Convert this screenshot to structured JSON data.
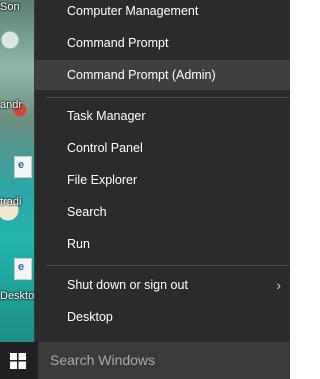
{
  "desktop": {
    "labels": [
      "Son",
      "andr",
      "tradi",
      "Desktop"
    ]
  },
  "menu": {
    "items": [
      {
        "label": "Computer Management"
      },
      {
        "label": "Command Prompt"
      },
      {
        "label": "Command Prompt (Admin)"
      },
      {
        "label": "Task Manager"
      },
      {
        "label": "Control Panel"
      },
      {
        "label": "File Explorer"
      },
      {
        "label": "Search"
      },
      {
        "label": "Run"
      },
      {
        "label": "Shut down or sign out"
      },
      {
        "label": "Desktop"
      }
    ]
  },
  "taskbar": {
    "start_icon": "windows-logo-icon",
    "search_placeholder": "Search Windows"
  },
  "colors": {
    "menu_bg": "#2b2b2b",
    "menu_hover": "#3f3f3f",
    "taskbar_bg": "#1b1b1b",
    "search_bg": "#3b3b3b",
    "text": "#ffffff"
  }
}
